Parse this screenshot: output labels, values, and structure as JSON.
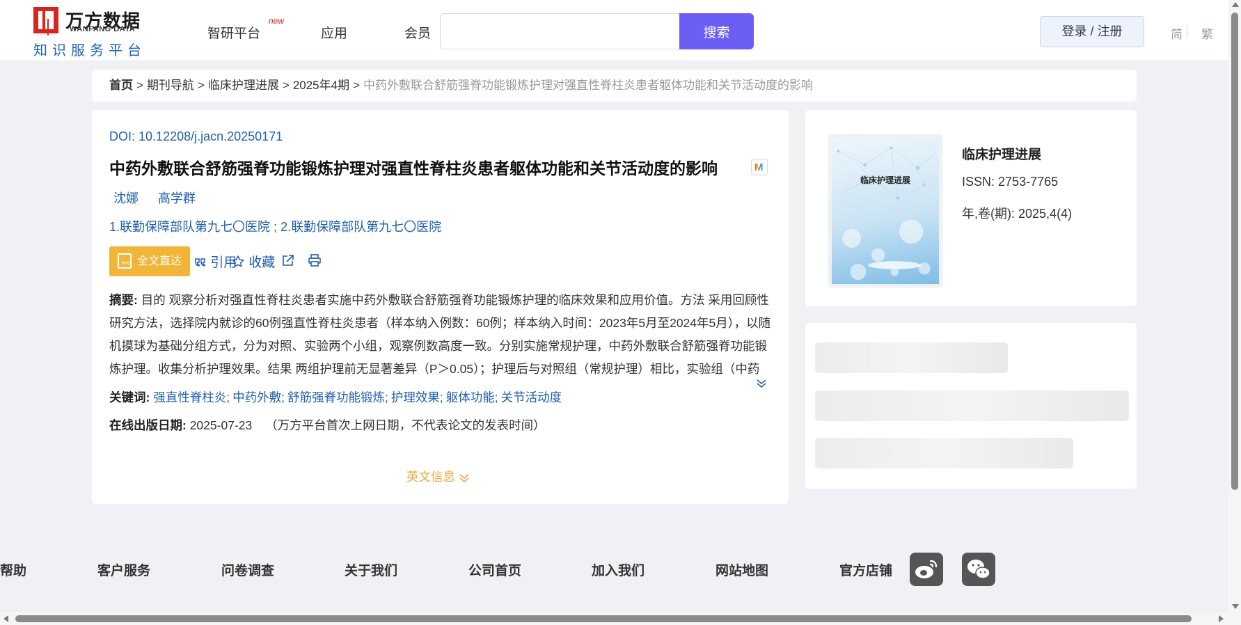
{
  "header": {
    "logo": {
      "name_cn": "万方数据",
      "name_en": "WANFANG DATA",
      "subtitle": "知识服务平台"
    },
    "nav": [
      {
        "label": "智研平台",
        "badge": "new"
      },
      {
        "label": "应用"
      },
      {
        "label": "会员"
      }
    ],
    "search": {
      "value": "",
      "placeholder": "",
      "button_label": "搜索"
    },
    "login_label": "登录 / 注册",
    "lang": {
      "simplified": "简",
      "traditional": "繁"
    }
  },
  "breadcrumb": {
    "items": [
      "首页",
      "期刊导航",
      "临床护理进展",
      "2025年4期"
    ],
    "current": "中药外敷联合舒筋强脊功能锻炼护理对强直性脊柱炎患者躯体功能和关节活动度的影响",
    "separator": ">"
  },
  "article": {
    "doi_label": "DOI:",
    "doi": "10.12208/j.jacn.20250171",
    "title": "中药外敷联合舒筋强脊功能锻炼护理对强直性脊柱炎患者躯体功能和关节活动度的影响",
    "authors": [
      "沈娜",
      "高学群"
    ],
    "orgs": [
      "1.联勤保障部队第九七〇医院",
      "2.联勤保障部队第九七〇医院"
    ],
    "org_separator": ";",
    "actions": {
      "fulltext_label": "全文直达",
      "cite_label": "引用",
      "collect_label": "收藏"
    },
    "abstract_label": "摘要:",
    "abstract": "目的 观察分析对强直性脊柱炎患者实施中药外敷联合舒筋强脊功能锻炼护理的临床效果和应用价值。方法 采用回顾性研究方法，选择院内就诊的60例强直性脊柱炎患者（样本纳入例数：60例；样本纳入时间：2023年5月至2024年5月），以随机摸球为基础分组方式，分为对照、实验两个小组，观察例数高度一致。分别实施常规护理，中药外敷联合舒筋强脊功能锻炼护理。收集分析护理效果。结果 两组护理前无显著差异（P＞0.05）；护理后与对照组（常规护理）相比，实验组（中药外敷联合舒筋强脊功能锻炼护理）躯体功能评分、焦虑评分、抑郁评分、疼痛程度评分更低，生活质量评分（角...",
    "keywords_label": "关键词:",
    "keywords": [
      "强直性脊柱炎",
      "中药外敷",
      "舒筋强脊功能锻炼",
      "护理效果",
      "躯体功能",
      "关节活动度"
    ],
    "keyword_separator": ";",
    "pubdate_label": "在线出版日期:",
    "pubdate": "2025-07-23",
    "pubdate_note": "（万方平台首次上网日期，不代表论文的发表时间）",
    "en_info_label": "英文信息"
  },
  "journal": {
    "cover_title": "临床护理进展",
    "name": "临床护理进展",
    "issn_label": "ISSN:",
    "issn": "2753-7765",
    "volume_label": "年,卷(期):",
    "volume": "2025,4(4)"
  },
  "footer": {
    "links": [
      "帮助",
      "客户服务",
      "问卷调查",
      "关于我们",
      "公司首页",
      "加入我们",
      "网站地图",
      "官方店铺"
    ],
    "social": [
      "weibo-icon",
      "wechat-icon"
    ]
  },
  "colors": {
    "accent": "#6a5ef5",
    "link": "#1f5fae",
    "fulltext_button": "#f1b53a",
    "brand_red": "#d7261e"
  }
}
